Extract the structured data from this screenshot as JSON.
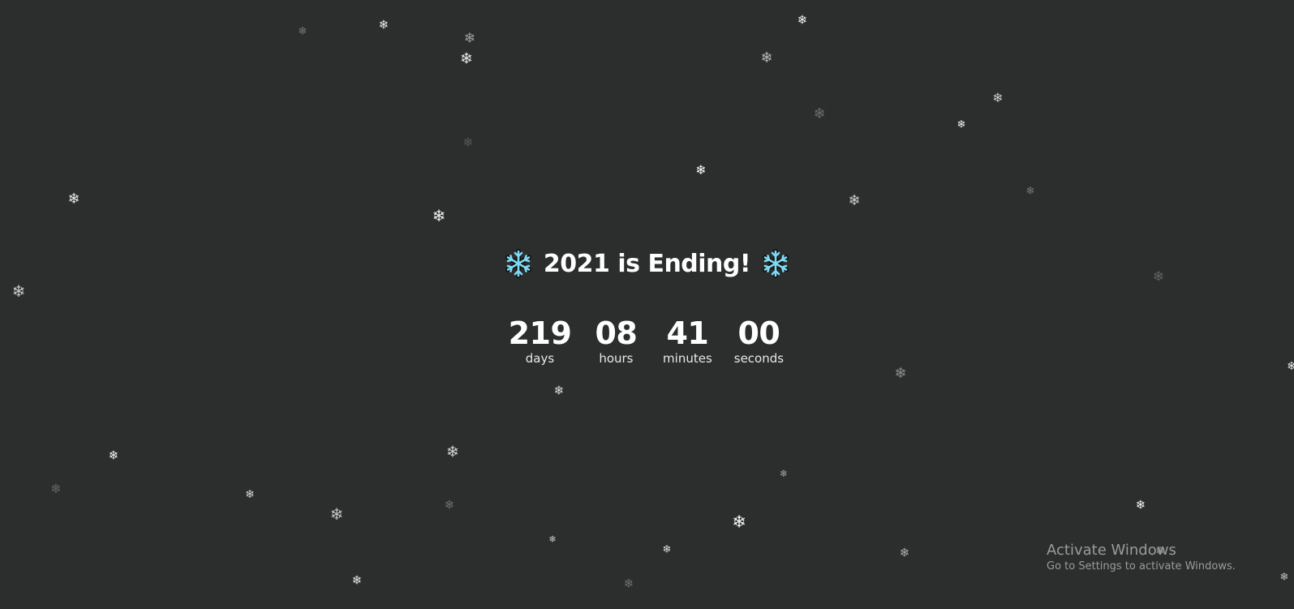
{
  "headline": {
    "text": "2021 is Ending!",
    "icon_left": "snowflake-icon",
    "icon_right": "snowflake-icon",
    "icon_color": "#7fd9f2"
  },
  "countdown": [
    {
      "value": "219",
      "label": "days"
    },
    {
      "value": "08",
      "label": "hours"
    },
    {
      "value": "41",
      "label": "minutes"
    },
    {
      "value": "00",
      "label": "seconds"
    }
  ],
  "background": {
    "color": "#2b2e2c",
    "decoration": "falling-snowflakes",
    "flake_glyph": "❄"
  },
  "watermark": {
    "title": "Activate Windows",
    "subtitle": "Go to Settings to activate Windows."
  }
}
